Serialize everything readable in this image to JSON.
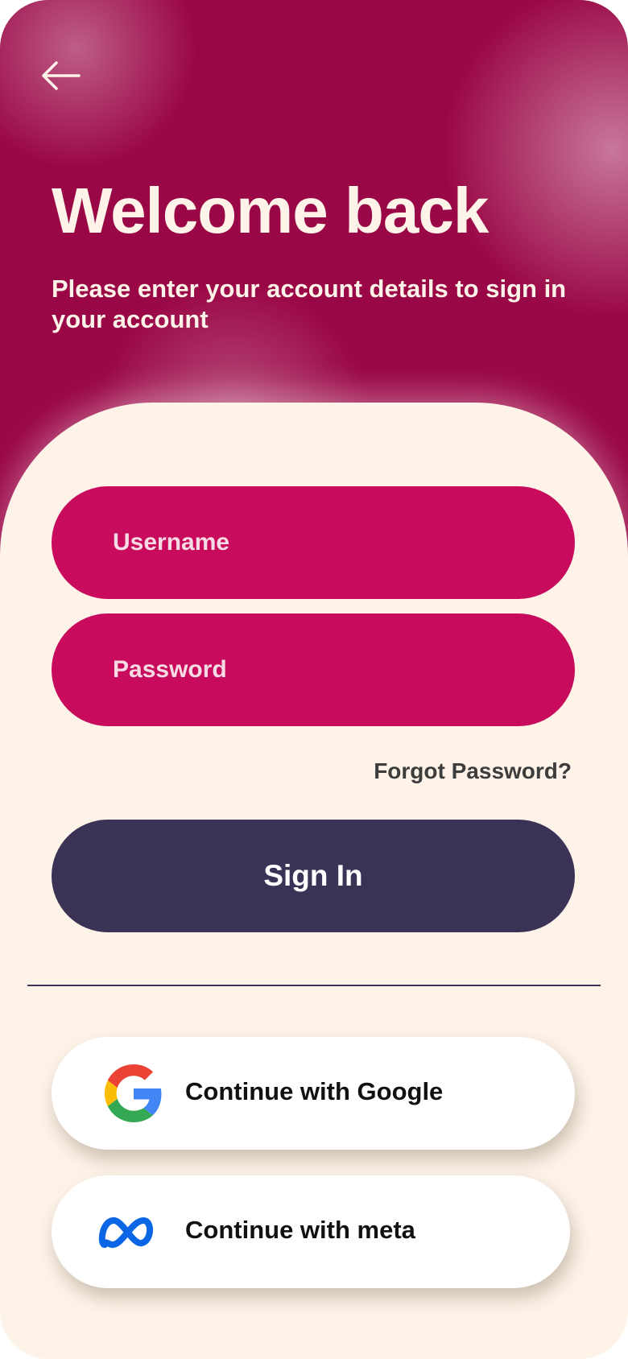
{
  "header": {
    "back_icon": "arrow-left-icon",
    "title": "Welcome back",
    "subtitle": "Please enter your account details to sign in your account"
  },
  "form": {
    "username_placeholder": "Username",
    "username_value": "",
    "password_placeholder": "Password",
    "password_value": "",
    "forgot_label": "Forgot Password?",
    "signin_label": "Sign In"
  },
  "social": {
    "google_label": "Continue with Google",
    "google_icon": "google-icon",
    "meta_label": "Continue with meta",
    "meta_icon": "meta-icon"
  },
  "colors": {
    "hero": "#9a0746",
    "field": "#c80b5c",
    "primary_button": "#3a3356",
    "card": "#fdf3e8",
    "meta_blue": "#0a66e4"
  }
}
